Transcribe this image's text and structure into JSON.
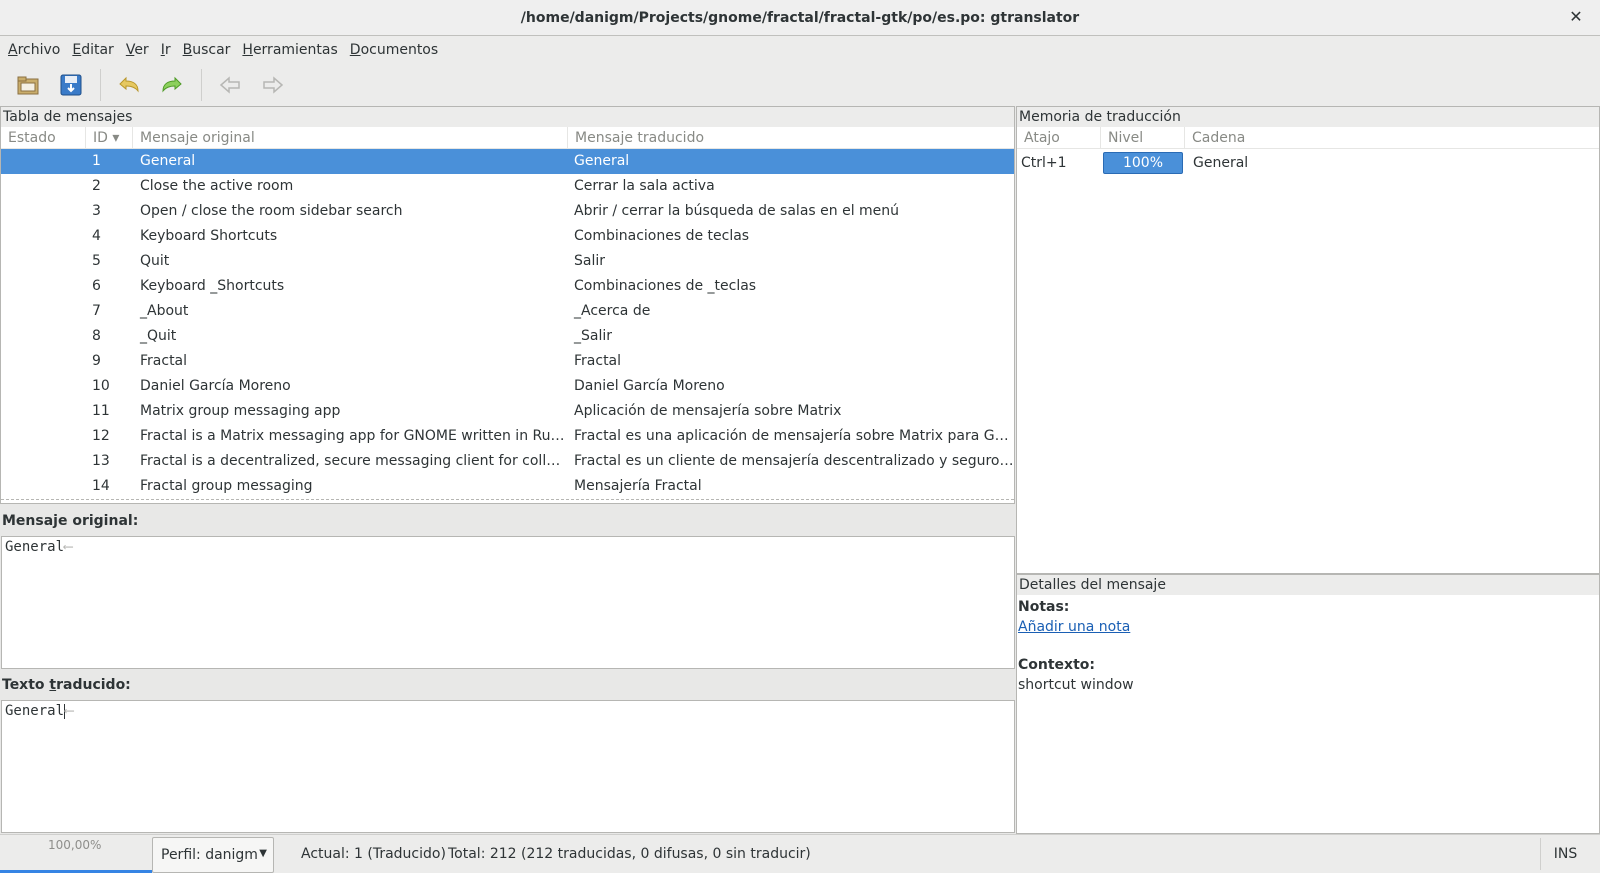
{
  "window": {
    "title": "/home/danigm/Projects/gnome/fractal/fractal-gtk/po/es.po: gtranslator",
    "close_glyph": "✕"
  },
  "menubar": [
    {
      "pre": "",
      "u": "A",
      "post": "rchivo"
    },
    {
      "pre": "",
      "u": "E",
      "post": "ditar"
    },
    {
      "pre": "",
      "u": "V",
      "post": "er"
    },
    {
      "pre": "",
      "u": "I",
      "post": "r"
    },
    {
      "pre": "",
      "u": "B",
      "post": "uscar"
    },
    {
      "pre": "",
      "u": "H",
      "post": "erramientas"
    },
    {
      "pre": "",
      "u": "D",
      "post": "ocumentos"
    }
  ],
  "toolbar": {
    "icons": [
      "open-folder-icon",
      "save-icon",
      "undo-icon",
      "redo-icon",
      "previous-message-icon",
      "next-message-icon"
    ],
    "colors": {
      "folder": "#b89a5a",
      "save": "#3a7bc8",
      "undo": "#d8b84a",
      "redo": "#73c04a",
      "nav_disabled": "#b7b7b4"
    }
  },
  "message_table": {
    "title": "Tabla de mensajes",
    "columns": {
      "estado": "Estado",
      "id": "ID",
      "original": "Mensaje original",
      "traducido": "Mensaje traducido"
    },
    "sort_glyph": "▾",
    "rows": [
      {
        "id": "1",
        "original": "General",
        "translated": "General"
      },
      {
        "id": "2",
        "original": "Close the active room",
        "translated": "Cerrar la sala activa"
      },
      {
        "id": "3",
        "original": "Open / close the room sidebar search",
        "translated": "Abrir / cerrar la búsqueda de salas en el menú"
      },
      {
        "id": "4",
        "original": "Keyboard Shortcuts",
        "translated": "Combinaciones de teclas"
      },
      {
        "id": "5",
        "original": "Quit",
        "translated": "Salir"
      },
      {
        "id": "6",
        "original": "Keyboard _Shortcuts",
        "translated": "Combinaciones de _teclas"
      },
      {
        "id": "7",
        "original": "_About",
        "translated": "_Acerca de"
      },
      {
        "id": "8",
        "original": "_Quit",
        "translated": "_Salir"
      },
      {
        "id": "9",
        "original": "Fractal",
        "translated": "Fractal"
      },
      {
        "id": "10",
        "original": "Daniel García Moreno",
        "translated": "Daniel García Moreno"
      },
      {
        "id": "11",
        "original": "Matrix group messaging app",
        "translated": "Aplicación de mensajería sobre Matrix"
      },
      {
        "id": "12",
        "original": "Fractal is a Matrix messaging app for GNOME written in Rust. I…",
        "translated": "Fractal es una aplicación de mensajería sobre Matrix para GNOM…"
      },
      {
        "id": "13",
        "original": "Fractal is a decentralized, secure messaging client for collabora…",
        "translated": "Fractal es un cliente de mensajería descentralizado y seguro para …"
      },
      {
        "id": "14",
        "original": "Fractal group messaging",
        "translated": "Mensajería Fractal"
      }
    ],
    "selected_index": 0
  },
  "original_message": {
    "label": "Mensaje original:",
    "text": "General",
    "return_glyph": "⟵"
  },
  "translated_text": {
    "label_pre": "Texto ",
    "label_u": "t",
    "label_post": "raducido:",
    "text": "General",
    "return_glyph": "⟵"
  },
  "translation_memory": {
    "title": "Memoria de traducción",
    "columns": {
      "atajo": "Atajo",
      "nivel": "Nivel",
      "cadena": "Cadena"
    },
    "rows": [
      {
        "shortcut": "Ctrl+1",
        "level": "100%",
        "string": "General"
      }
    ]
  },
  "message_details": {
    "title": "Detalles del mensaje",
    "notes_label": "Notas:",
    "add_note_link": "Añadir una nota",
    "context_label": "Contexto:",
    "context_value": "shortcut window"
  },
  "statusbar": {
    "progress_text": "100,00%",
    "progress_fraction": 1.0,
    "profile": "Perfil:  danigm",
    "profile_chevron": "▼",
    "actual": "Actual: 1 (Traducido)",
    "total": "Total: 212 (212 traducidas, 0 difusas, 0 sin traducir)",
    "mode": "INS"
  }
}
